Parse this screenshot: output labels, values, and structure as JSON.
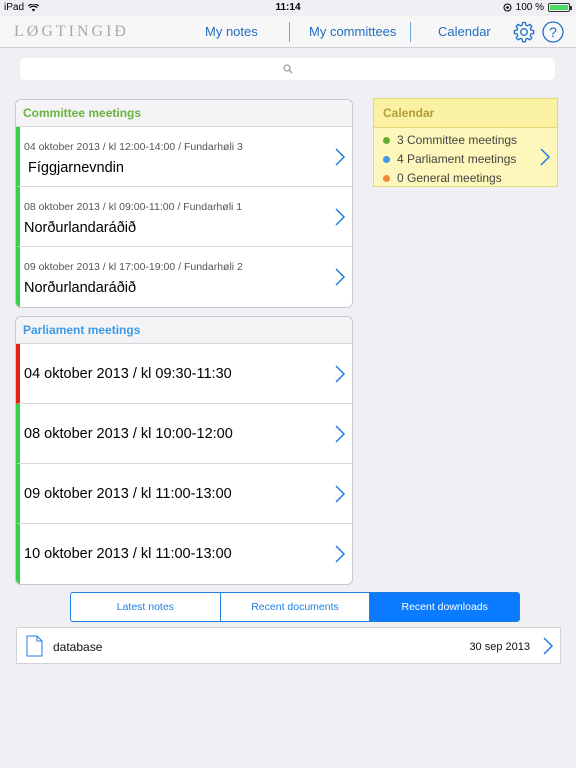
{
  "status": {
    "device": "iPad",
    "time": "11:14",
    "battery": "100 %"
  },
  "nav": {
    "logo": "LØGTINGIÐ",
    "my_notes": "My notes",
    "my_committees": "My committees",
    "calendar": "Calendar"
  },
  "search": {
    "placeholder": ""
  },
  "committee_meetings": {
    "title": "Committee meetings",
    "items": [
      {
        "meta": "04 oktober 2013 / kl 12:00-14:00 / Fundarhøli 3",
        "name": "Fíggjarnevndin"
      },
      {
        "meta": "08 oktober 2013 / kl 09:00-11:00 / Fundarhøli 1",
        "name": "Norðurlandaráðið"
      },
      {
        "meta": "09 oktober 2013 / kl 17:00-19:00 / Fundarhøli 2",
        "name": "Norðurlandaráðið"
      }
    ]
  },
  "parliament_meetings": {
    "title": "Parliament meetings",
    "items": [
      {
        "label": "04 oktober 2013 / kl 09:30-11:30",
        "status_color": "#e2231a"
      },
      {
        "label": "08 oktober 2013 / kl 10:00-12:00",
        "status_color": "#33d14a"
      },
      {
        "label": "09 oktober 2013 / kl 11:00-13:00",
        "status_color": "#33d14a"
      },
      {
        "label": "10 oktober 2013 / kl 11:00-13:00",
        "status_color": "#33d14a"
      }
    ]
  },
  "calendar_panel": {
    "title": "Calendar",
    "lines": [
      {
        "text": "3 Committee meetings",
        "color": "#5fb034"
      },
      {
        "text": "4 Parliament meetings",
        "color": "#3d9be6"
      },
      {
        "text": "0 General meetings",
        "color": "#f08a3c"
      }
    ]
  },
  "tabs": {
    "latest_notes": "Latest notes",
    "recent_documents": "Recent documents",
    "recent_downloads": "Recent downloads"
  },
  "downloads": [
    {
      "name": "database",
      "date": "30 sep 2013"
    }
  ],
  "colors": {
    "accent": "#1e7fe0",
    "committee_title": "#6bb33c",
    "parliament_title": "#3d9be6"
  }
}
